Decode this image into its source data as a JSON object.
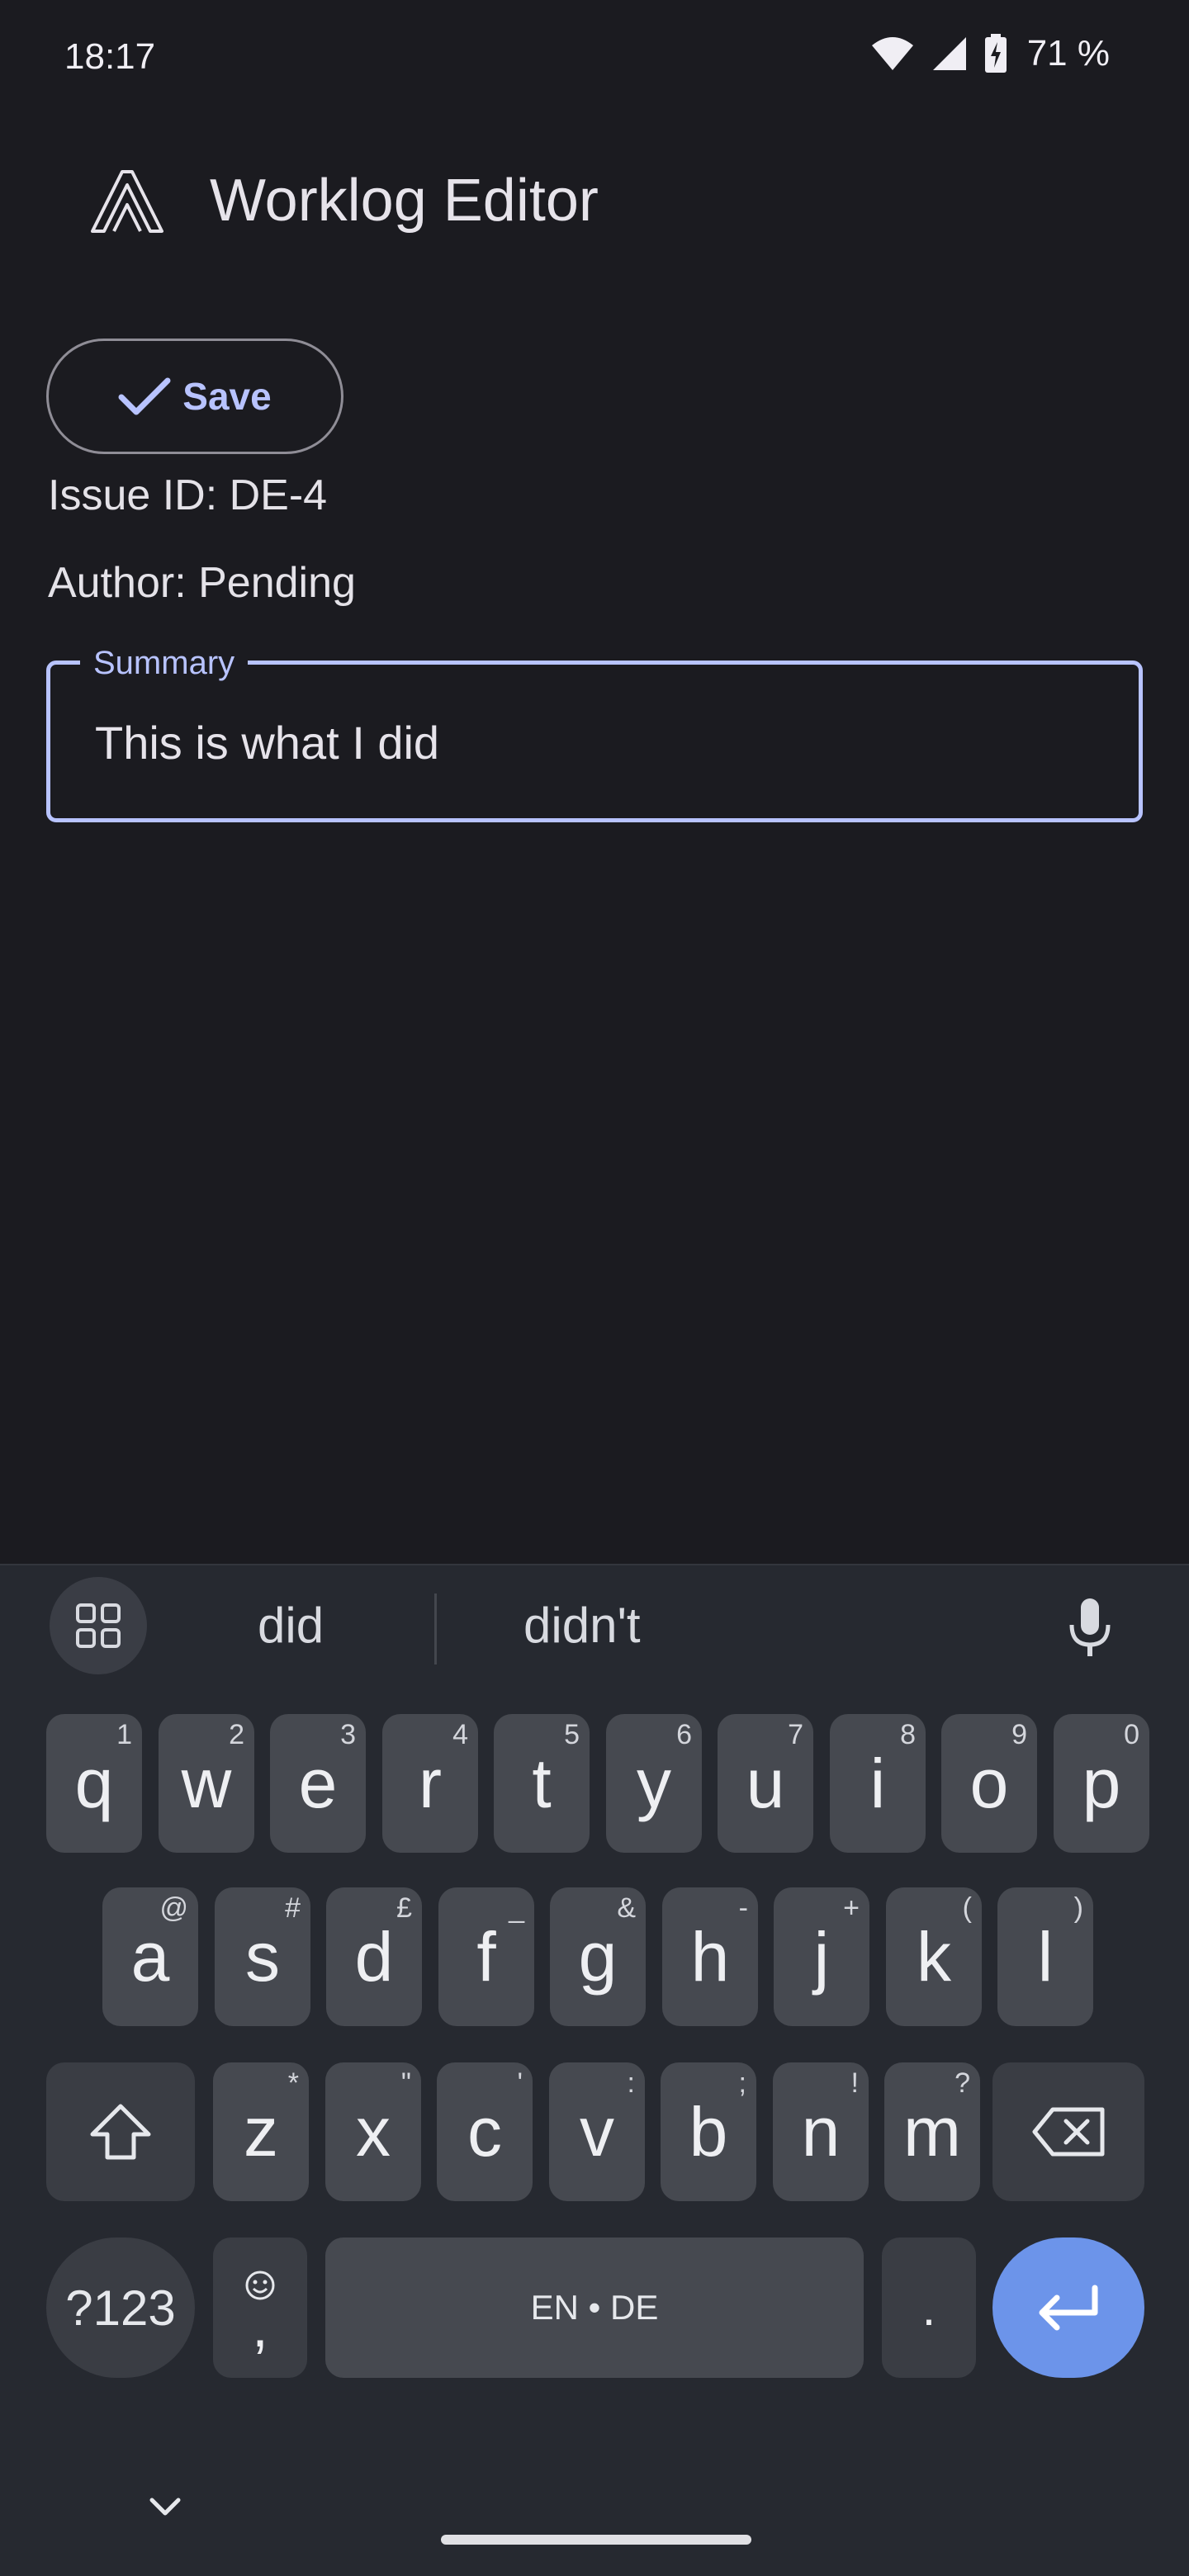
{
  "status_bar": {
    "time": "18:17",
    "battery": "71 %",
    "icons": [
      "wifi-icon",
      "cellular-signal-icon",
      "battery-charging-icon"
    ]
  },
  "app_bar": {
    "title": "Worklog Editor",
    "logo_icon": "app-logo-icon"
  },
  "content": {
    "save_label": "Save",
    "save_icon": "check-icon",
    "issue_id": "Issue ID: DE-4",
    "author": "Author: Pending",
    "summary": {
      "label": "Summary",
      "value": "This is what I did"
    }
  },
  "keyboard": {
    "suggestions": [
      "did",
      "didn't"
    ],
    "row1": [
      {
        "key": "q",
        "hint": "1"
      },
      {
        "key": "w",
        "hint": "2"
      },
      {
        "key": "e",
        "hint": "3"
      },
      {
        "key": "r",
        "hint": "4"
      },
      {
        "key": "t",
        "hint": "5"
      },
      {
        "key": "y",
        "hint": "6"
      },
      {
        "key": "u",
        "hint": "7"
      },
      {
        "key": "i",
        "hint": "8"
      },
      {
        "key": "o",
        "hint": "9"
      },
      {
        "key": "p",
        "hint": "0"
      }
    ],
    "row2": [
      {
        "key": "a",
        "hint": "@"
      },
      {
        "key": "s",
        "hint": "#"
      },
      {
        "key": "d",
        "hint": "£"
      },
      {
        "key": "f",
        "hint": "_"
      },
      {
        "key": "g",
        "hint": "&"
      },
      {
        "key": "h",
        "hint": "-"
      },
      {
        "key": "j",
        "hint": "+"
      },
      {
        "key": "k",
        "hint": "("
      },
      {
        "key": "l",
        "hint": ")"
      }
    ],
    "row3": [
      {
        "key": "z",
        "hint": "*"
      },
      {
        "key": "x",
        "hint": "\""
      },
      {
        "key": "c",
        "hint": "'"
      },
      {
        "key": "v",
        "hint": ":"
      },
      {
        "key": "b",
        "hint": ";"
      },
      {
        "key": "n",
        "hint": "!"
      },
      {
        "key": "m",
        "hint": "?"
      }
    ],
    "symbols_label": "?123",
    "comma_label": ",",
    "space_label": "EN • DE",
    "period_label": ".",
    "accent_color": "#6c94ea"
  },
  "colors": {
    "background": "#1b1b20",
    "primary": "#b8c3ff"
  }
}
